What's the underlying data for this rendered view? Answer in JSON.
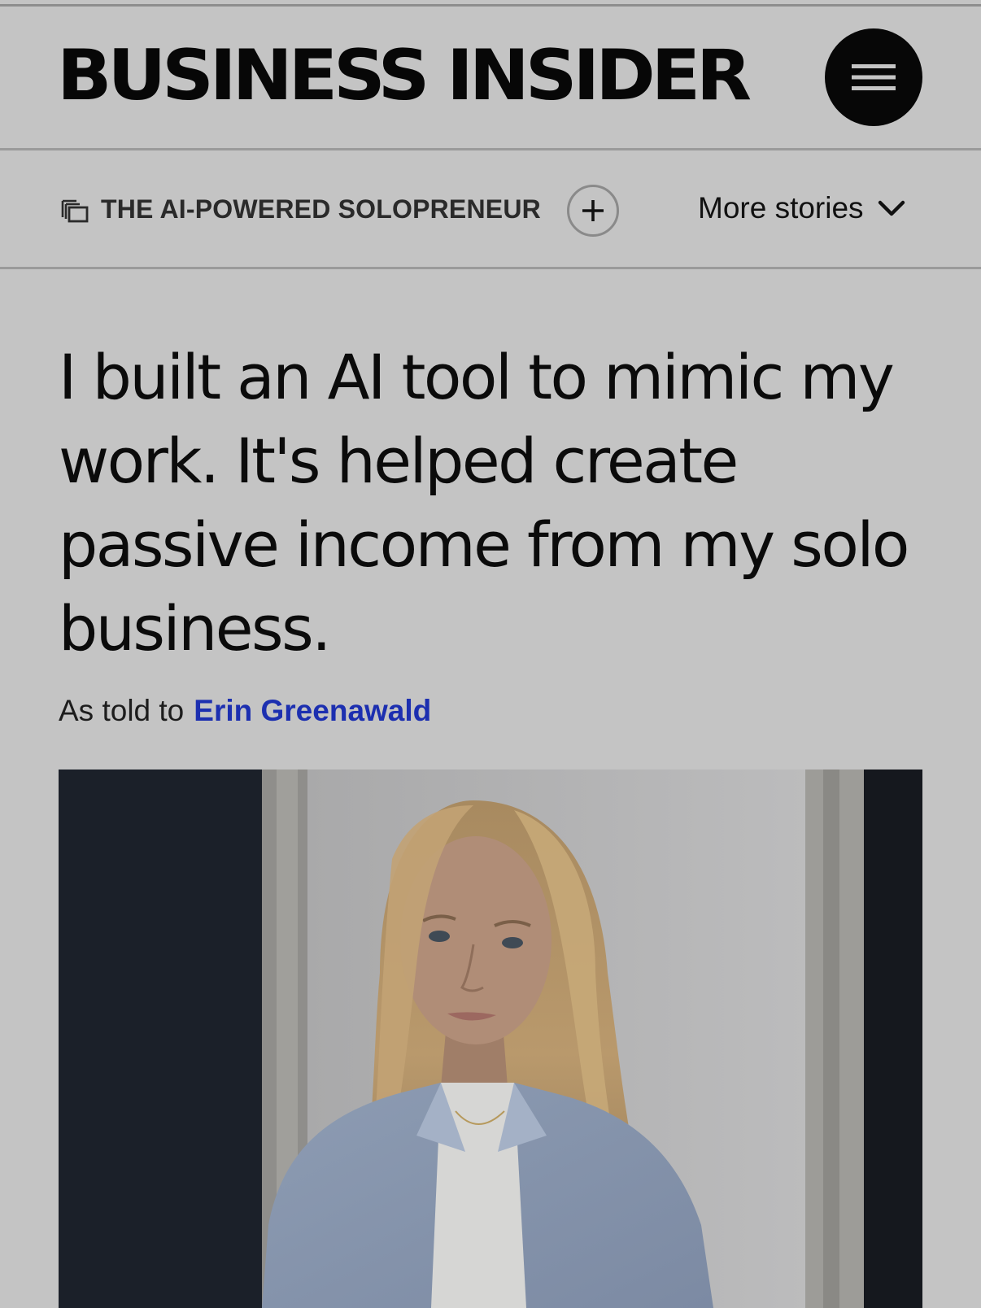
{
  "masthead": {
    "logo_text": "BUSINESS INSIDER",
    "menu_icon": "hamburger-menu-icon"
  },
  "topic_bar": {
    "topic_icon": "stacked-pages-icon",
    "topic_label": "THE AI-POWERED SOLOPRENEUR",
    "follow_icon": "plus-icon",
    "more_stories_label": "More stories",
    "more_stories_icon": "chevron-down-icon"
  },
  "article": {
    "headline": "I built an AI tool to mimic my work. It's helped create passive income from my solo business.",
    "byline_prefix": "As told to",
    "author_name": "Erin Greenawald"
  },
  "colors": {
    "background": "#c4c4c4",
    "text": "#0a0a0a",
    "author_link": "#1c2fb0"
  }
}
